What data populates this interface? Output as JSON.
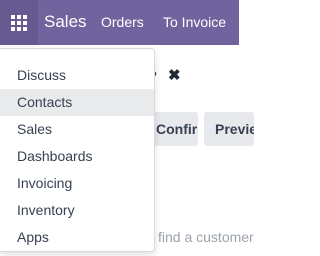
{
  "navbar": {
    "brand": "Sales",
    "links": [
      "Orders",
      "To Invoice"
    ],
    "background_color": "#71639e",
    "apps_icon": "apps-grid-icon"
  },
  "background_page": {
    "question_mark": "?",
    "close_icon": "✖",
    "confirm_button": "Confirm",
    "preview_button": "Preview",
    "customer_placeholder": "find a customer"
  },
  "apps_menu": {
    "items": [
      "Discuss",
      "Contacts",
      "Sales",
      "Dashboards",
      "Invoicing",
      "Inventory",
      "Apps"
    ],
    "hovered_item": "Contacts"
  }
}
